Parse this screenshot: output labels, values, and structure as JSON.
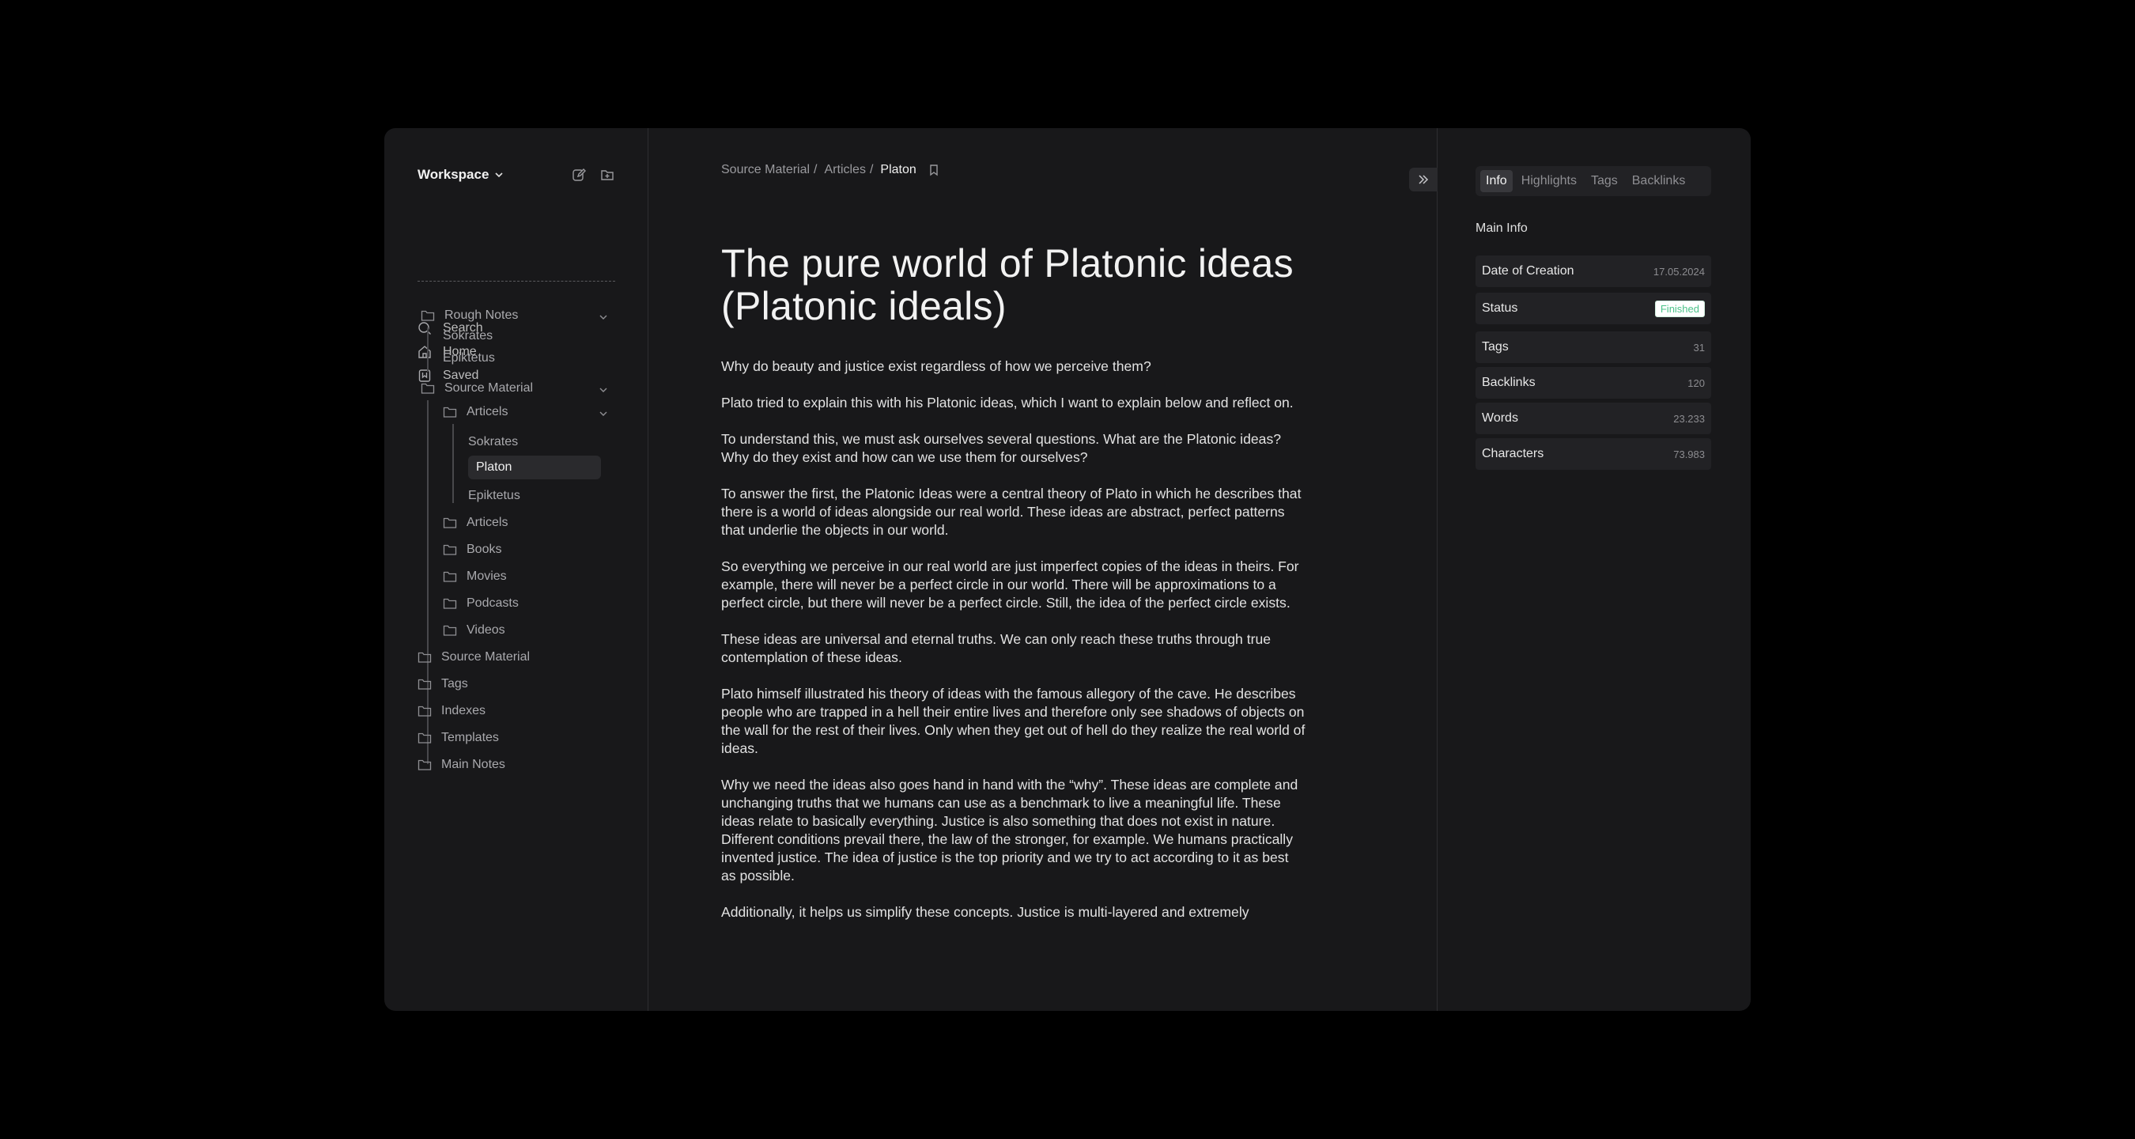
{
  "sidebar": {
    "workspace": "Workspace",
    "nav": [
      {
        "label": "Search",
        "icon": "search-icon"
      },
      {
        "label": "Home",
        "icon": "home-icon"
      },
      {
        "label": "Saved",
        "icon": "bookmark-icon"
      }
    ],
    "tree": {
      "rough_notes": "Rough Notes",
      "rough_children": [
        "Sokrates",
        "Epiktetus"
      ],
      "source_material": "Source Material",
      "articels": "Articels",
      "articels_children": [
        "Sokrates",
        "Platon",
        "Epiktetus"
      ],
      "source_folders": [
        "Articels",
        "Books",
        "Movies",
        "Podcasts",
        "Videos"
      ],
      "root_folders": [
        "Source Material",
        "Tags",
        "Indexes",
        "Templates",
        "Main Notes"
      ]
    }
  },
  "breadcrumb": {
    "items": [
      "Source Material",
      "Articles"
    ],
    "separator": "/",
    "current": "Platon"
  },
  "document": {
    "title": "The pure world of Platonic ideas (Platonic ideals)",
    "paragraphs": [
      "Why do beauty and justice exist regardless of how we perceive them?",
      "Plato tried to explain this with his Platonic ideas, which I want to explain below and reflect on.",
      "To understand this, we must ask ourselves several questions. What are the Platonic ideas? Why do they exist and how can we use them for ourselves?",
      "To answer the first, the Platonic Ideas were a central theory of Plato in which he describes that there is a world of ideas alongside our real world. These ideas are abstract, perfect patterns that underlie the objects in our world.",
      "So everything we perceive in our real world are just imperfect copies of the ideas in theirs. For example, there will never be a perfect circle in our world. There will be approximations to a perfect circle, but there will never be a perfect circle. Still, the idea of the perfect circle exists.",
      "These ideas are universal and eternal truths. We can only reach these truths through true contemplation of these ideas.",
      "Plato himself illustrated his theory of ideas with the famous allegory of the cave. He describes people who are trapped in a hell their entire lives and therefore only see shadows of objects on the wall for the rest of their lives. Only when they get out of hell do they realize the real world of ideas.",
      "Why we need the ideas also goes hand in hand with the “why”. These ideas are complete and unchanging truths that we humans can use as a benchmark to live a meaningful life. These ideas relate to basically everything. Justice is also something that does not exist in nature. Different conditions prevail there, the law of the stronger, for example. We humans practically invented justice. The idea of justice is the top priority and we try to act according to it as best as possible.",
      "Additionally, it helps us simplify these concepts. Justice is multi-layered and extremely"
    ]
  },
  "panel": {
    "tabs": [
      "Info",
      "Highlights",
      "Tags",
      "Backlinks"
    ],
    "active_tab": "Info",
    "heading": "Main Info",
    "rows": [
      {
        "label": "Date of Creation",
        "value": "17.05.2024"
      },
      {
        "label": "Status",
        "value": "Finished"
      },
      {
        "label": "Tags",
        "value": "31"
      },
      {
        "label": "Backlinks",
        "value": "120"
      },
      {
        "label": "Words",
        "value": "23.233"
      },
      {
        "label": "Characters",
        "value": "73.983"
      }
    ],
    "status_color": "#4cc38a"
  }
}
